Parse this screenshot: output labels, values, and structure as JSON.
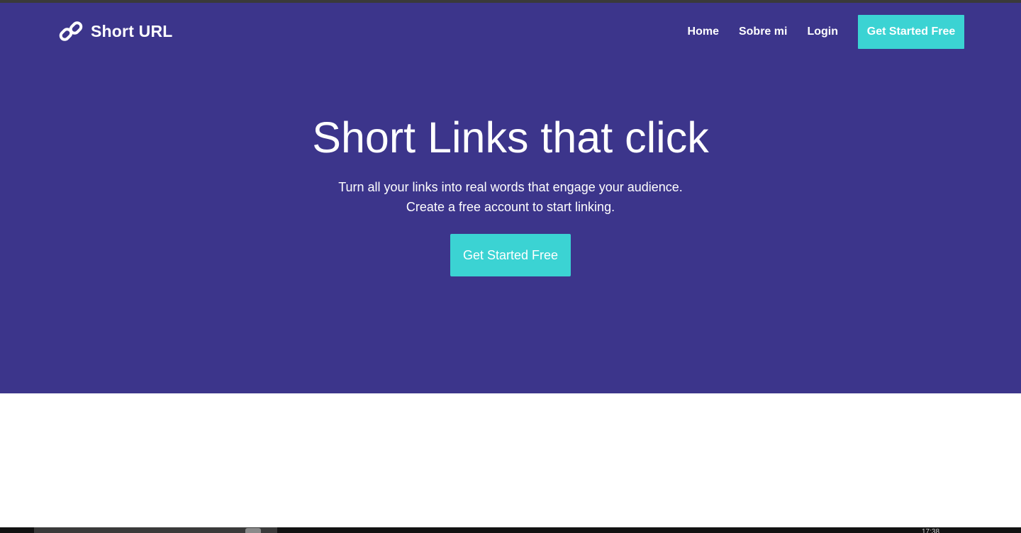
{
  "nav": {
    "brand": "Short URL",
    "brand_icon": "link-chain-icon",
    "links": [
      "Home",
      "Sobre mi",
      "Login"
    ],
    "cta": "Get Started Free"
  },
  "hero": {
    "title": "Short Links that click",
    "subtitle_line1": "Turn all your links into real words that engage your audience.",
    "subtitle_line2": "Create a free account to start linking.",
    "cta": "Get Started Free"
  },
  "taskbar": {
    "clock": "17:38"
  },
  "colors": {
    "hero_bg": "#3c358b",
    "accent": "#3bd3d3",
    "text_on_hero": "#ffffff"
  }
}
